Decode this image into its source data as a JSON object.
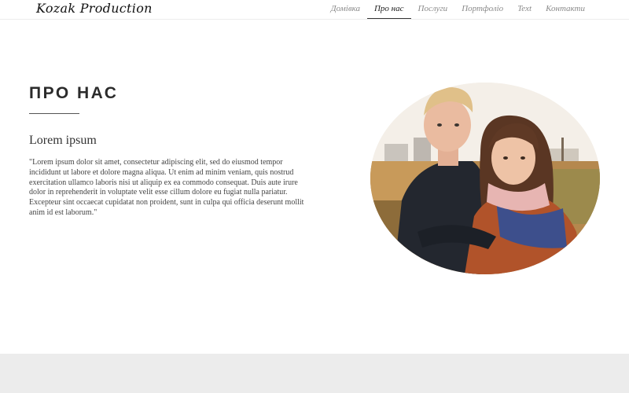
{
  "header": {
    "logo_text": "Kozak Production",
    "nav": [
      {
        "label": "Домівка",
        "active": false
      },
      {
        "label": "Про нас",
        "active": true
      },
      {
        "label": "Послуги",
        "active": false
      },
      {
        "label": "Портфоліо",
        "active": false
      },
      {
        "label": "Text",
        "active": false
      },
      {
        "label": "Контакти",
        "active": false
      }
    ]
  },
  "about": {
    "title": "ПРО НАС",
    "subtitle": "Lorem ipsum",
    "body": "\"Lorem ipsum dolor sit amet, consectetur adipiscing elit, sed do eiusmod tempor incididunt ut labore et dolore magna aliqua. Ut enim ad minim veniam, quis nostrud exercitation ullamco laboris nisi ut aliquip ex ea commodo consequat. Duis aute irure dolor in reprehenderit in voluptate velit esse cillum dolore eu fugiat nulla pariatur. Excepteur sint occaecat cupidatat non proident, sunt in culpa qui officia deserunt mollit anim id est laborum.\""
  },
  "colors": {
    "accent_text": "#2b2b2b",
    "nav_inactive": "#8a8a8a",
    "footer_bg": "#ececec"
  }
}
